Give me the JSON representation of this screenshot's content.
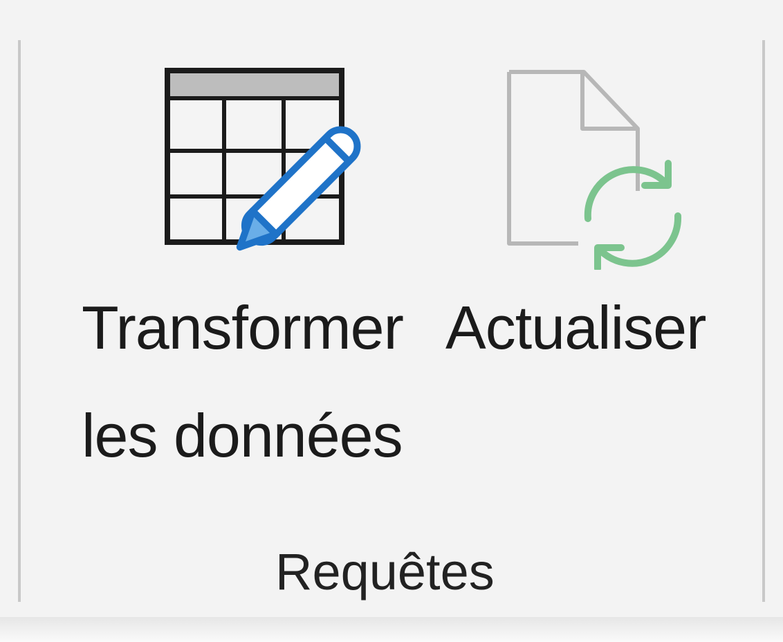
{
  "ribbon_group": {
    "label": "Requêtes",
    "buttons": {
      "transform": {
        "label_line1": "Transformer",
        "label_line2": "les données",
        "icon": "table-edit-icon"
      },
      "refresh": {
        "label_line1": "Actualiser",
        "icon": "document-refresh-icon"
      }
    }
  },
  "colors": {
    "background": "#f3f3f3",
    "pencil_blue": "#1f73c8",
    "refresh_green": "#7cc48e",
    "disabled_gray": "#b7b7b7"
  }
}
